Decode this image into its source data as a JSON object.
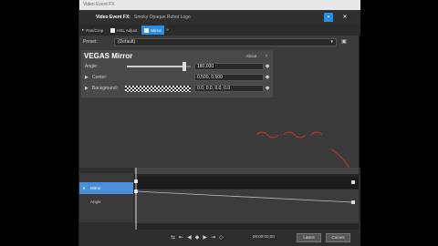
{
  "window": {
    "app_title": "Video Event FX",
    "title_main": "Video Event FX:",
    "title_sub": "Smoky Opaque Robot Logo"
  },
  "chain": {
    "items": [
      {
        "label": "Pan/Crop",
        "active": false
      },
      {
        "label": "HSL Adjust",
        "active": false
      },
      {
        "label": "Mirror",
        "active": true
      }
    ]
  },
  "preset": {
    "label": "Preset:",
    "value": "(Default)"
  },
  "effect": {
    "name": "VEGAS Mirror",
    "about": "About",
    "about_icon": "?",
    "params": {
      "angle_label": "Angle:",
      "angle_value": "180.000",
      "angle_fraction": 0.9,
      "center_label": "Center:",
      "center_value": "0.500, 0.500",
      "background_label": "Background:",
      "background_value": "0.0, 0.0, 0.0, 0.0"
    }
  },
  "annotation": {
    "text": "~~~ ~~~"
  },
  "timeline": {
    "row_selected": "Mirror",
    "row_param": "Angle",
    "timecode": "00:00:00;00",
    "latest_label": "Latest",
    "curve_label": "Curves"
  }
}
